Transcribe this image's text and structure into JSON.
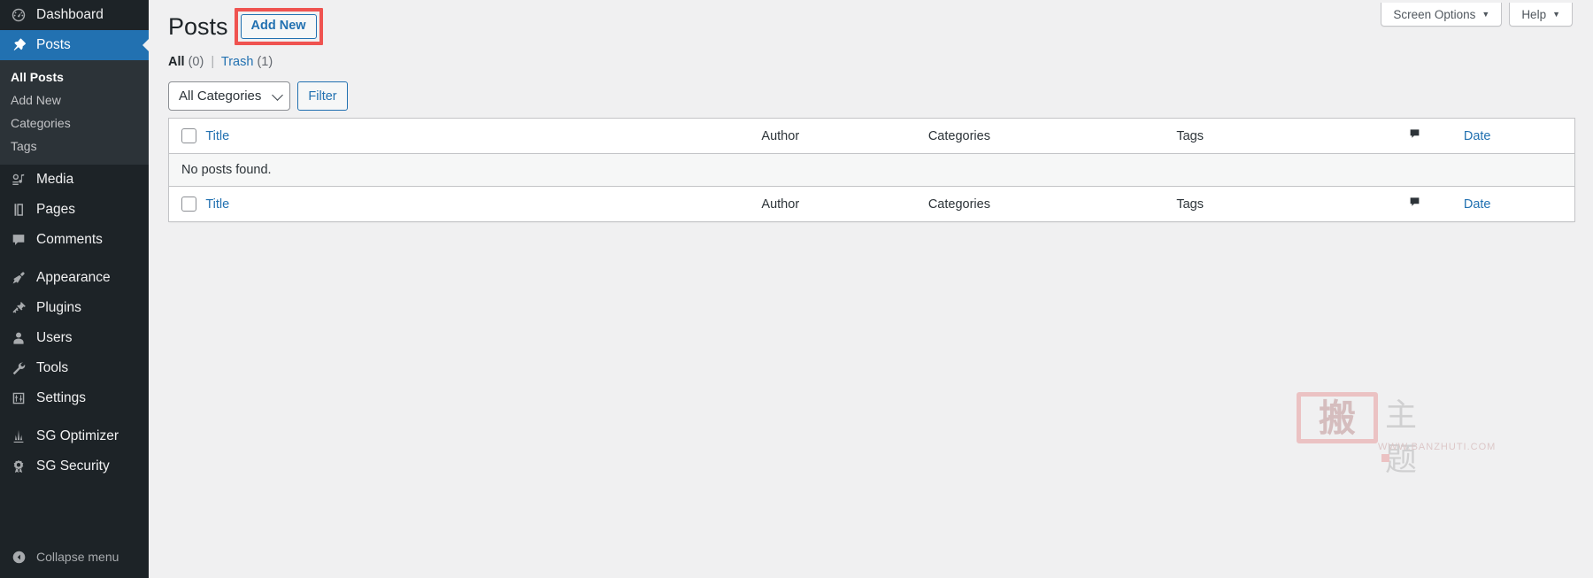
{
  "sidebar": {
    "items": [
      {
        "label": "Dashboard",
        "icon": "dashboard-icon",
        "current": false
      },
      {
        "label": "Posts",
        "icon": "pin-icon",
        "current": true
      },
      {
        "label": "Media",
        "icon": "media-icon",
        "current": false
      },
      {
        "label": "Pages",
        "icon": "pages-icon",
        "current": false
      },
      {
        "label": "Comments",
        "icon": "comments-icon",
        "current": false
      },
      {
        "label": "Appearance",
        "icon": "appearance-brush-icon",
        "current": false
      },
      {
        "label": "Plugins",
        "icon": "plugins-plug-icon",
        "current": false
      },
      {
        "label": "Users",
        "icon": "users-icon",
        "current": false
      },
      {
        "label": "Tools",
        "icon": "tools-wrench-icon",
        "current": false
      },
      {
        "label": "Settings",
        "icon": "settings-sliders-icon",
        "current": false
      },
      {
        "label": "SG Optimizer",
        "icon": "sg-optimizer-icon",
        "current": false
      },
      {
        "label": "SG Security",
        "icon": "sg-security-shield-icon",
        "current": false
      }
    ],
    "submenu": [
      {
        "label": "All Posts",
        "current": true
      },
      {
        "label": "Add New",
        "current": false
      },
      {
        "label": "Categories",
        "current": false
      },
      {
        "label": "Tags",
        "current": false
      }
    ],
    "collapse": {
      "label": "Collapse menu",
      "icon": "collapse-arrow-icon"
    }
  },
  "screen_meta": {
    "screen_options": "Screen Options",
    "help": "Help",
    "caret": "▼"
  },
  "header": {
    "title": "Posts",
    "add_new": "Add New"
  },
  "views": {
    "all_label": "All",
    "all_count": "(0)",
    "separator": "|",
    "trash_label": "Trash",
    "trash_count": "(1)"
  },
  "filters": {
    "category_select": "All Categories",
    "filter_button": "Filter"
  },
  "table": {
    "columns": {
      "title": "Title",
      "author": "Author",
      "categories": "Categories",
      "tags": "Tags",
      "comments_icon": "comment-bubble-icon",
      "date": "Date"
    },
    "empty_message": "No posts found."
  },
  "watermark": {
    "stamp_char": "搬",
    "chars": "主 题",
    "url": "WWW.BANZHUTI.COM"
  },
  "colors": {
    "sidebar_bg": "#1d2327",
    "submenu_bg": "#2c3338",
    "accent_blue": "#2271b1",
    "page_bg": "#f0f0f1",
    "highlight_red": "#ef5350",
    "border": "#c3c4c7"
  }
}
